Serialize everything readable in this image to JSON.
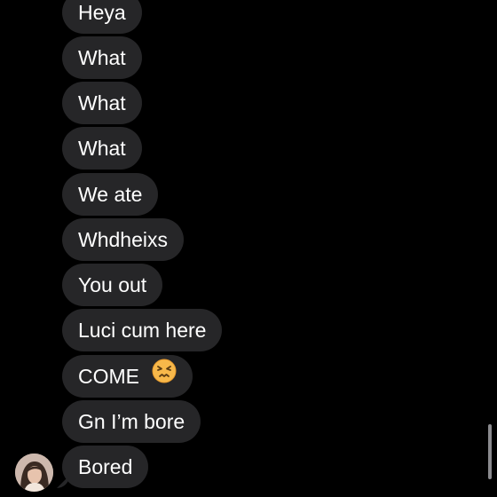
{
  "messages": [
    {
      "text": "Heya"
    },
    {
      "text": "What"
    },
    {
      "text": "What"
    },
    {
      "text": "What"
    },
    {
      "text": "We ate"
    },
    {
      "text": "Whdheixs"
    },
    {
      "text": "You out"
    },
    {
      "text": "Luci cum here"
    },
    {
      "text": "COME",
      "emoji": "confounded-face-emoji"
    },
    {
      "text": "Gn I’m bore"
    },
    {
      "text": "Bored"
    }
  ],
  "colors": {
    "background": "#000000",
    "bubble": "#262628",
    "text": "#ffffff",
    "emoji_face": "#f7b84a"
  }
}
